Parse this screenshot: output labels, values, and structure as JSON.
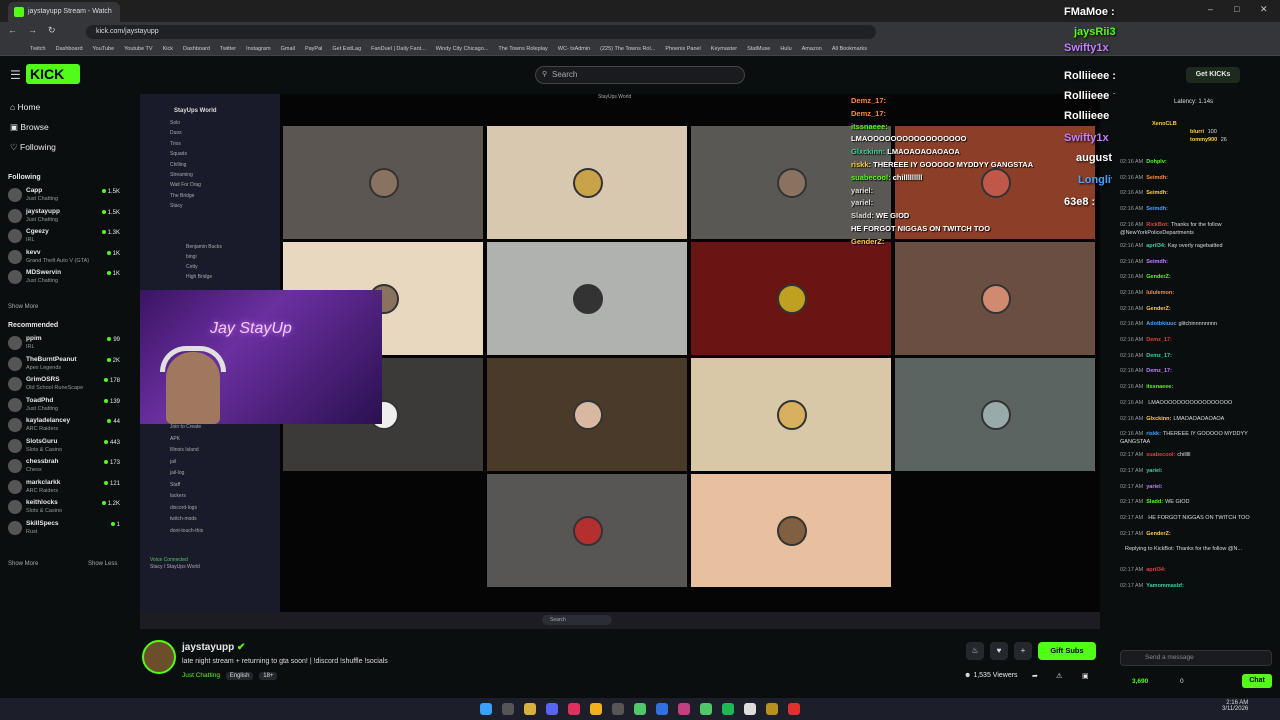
{
  "browser": {
    "tab_title": "jaystayupp Stream - Watch",
    "url": "kick.com/jaystayupp",
    "bookmarks": [
      "Twitch",
      "Dashboard",
      "YouTube",
      "Youtube TV",
      "Kick",
      "Dashboard",
      "Twitter",
      "Instagram",
      "Gmail",
      "PayPal",
      "Get ExitLag",
      "FanDuel | Daily Fant...",
      "Windy City Chicago...",
      "The Towns Roleplay",
      "WC- txAdmin",
      "(225) The Towns Rol...",
      "Phoenix Panel",
      "Keymaster",
      "StatMuse",
      "Hulu",
      "Amazon",
      "All Bookmarks"
    ]
  },
  "header": {
    "logo_text": "KICK",
    "search_placeholder": "Search",
    "get_kicks_label": "Get KICKs"
  },
  "sidebar": {
    "nav": [
      "Home",
      "Browse",
      "Following"
    ],
    "following_label": "Following",
    "following": [
      {
        "name": "Capp",
        "category": "Just Chatting",
        "viewers": "1.5K"
      },
      {
        "name": "jaystayupp",
        "category": "Just Chatting",
        "viewers": "1.5K"
      },
      {
        "name": "Cgeezy",
        "category": "IRL",
        "viewers": "1.3K"
      },
      {
        "name": "kevv",
        "category": "Grand Theft Auto V (GTA)",
        "viewers": "1K"
      },
      {
        "name": "MDSwervin",
        "category": "Just Chatting",
        "viewers": "1K"
      }
    ],
    "show_more_1": "Show More",
    "recommended_label": "Recommended",
    "recommended": [
      {
        "name": "ppim",
        "category": "IRL",
        "viewers": "99"
      },
      {
        "name": "TheBurntPeanut",
        "category": "Apex Legends",
        "viewers": "2K"
      },
      {
        "name": "GrimOSRS",
        "category": "Old School RuneScape",
        "viewers": "178"
      },
      {
        "name": "ToadPhd",
        "category": "Just Chatting",
        "viewers": "139"
      },
      {
        "name": "kayladelancey",
        "category": "ARC Raiders",
        "viewers": "44"
      },
      {
        "name": "SlotsGuru",
        "category": "Slots & Casino",
        "viewers": "443"
      },
      {
        "name": "chessbrah",
        "category": "Chess",
        "viewers": "173"
      },
      {
        "name": "markclarkk",
        "category": "ARC Raiders",
        "viewers": "121"
      },
      {
        "name": "keithlocks",
        "category": "Slots & Casino",
        "viewers": "1.2K"
      },
      {
        "name": "SkillSpecs",
        "category": "Rust",
        "viewers": "1"
      }
    ],
    "show_more_2": "Show More",
    "show_less": "Show Less"
  },
  "video": {
    "server_name": "StayUps World",
    "window_title": "StayUps World",
    "channels": [
      "Solo",
      "Duos",
      "Trios",
      "Squads",
      "Chilling",
      "Streaming",
      "Wait For Drag",
      "The Bridge",
      "Stacy"
    ],
    "members": [
      "Benjamin Bucks",
      "bingi",
      "Cetty",
      "High Bridge"
    ],
    "lower_channels": [
      "Join to Create",
      "APK",
      "Illinois Island",
      "jail",
      "jail-log",
      "Staff",
      "lackers",
      "discord-logs",
      "twitch-mods",
      "dont-touch-this"
    ],
    "voice_status": "Voice Connected",
    "voice_sub": "Stacy / StayUps World",
    "webcam_sign": "Jay StayUp",
    "taskbar_search": "Search",
    "overlay_chat": [
      {
        "user": "Demz_17:",
        "text": ""
      },
      {
        "user": "Demz_17:",
        "text": ""
      },
      {
        "user": "itssnaeee:",
        "text": ""
      },
      {
        "user": "",
        "text": "LMAOOOOOOOOOOOOOOOOO"
      },
      {
        "user": "Glxckinn:",
        "text": "LMAOAOAOAOAOA"
      },
      {
        "user": "riskk:",
        "text": "THEREEE IY GOOOOO MYDDYY GANGSTAA"
      },
      {
        "user": "suabecool:",
        "text": "chilllllllll"
      },
      {
        "user": "yariel:",
        "text": ""
      },
      {
        "user": "yariel:",
        "text": ""
      },
      {
        "user": "Sladd:",
        "text": "WE GIOD"
      },
      {
        "user": "",
        "text": "HE FORGOT NIGGAS ON TWITCH TOO"
      },
      {
        "user": "GenderZ:",
        "text": ""
      }
    ],
    "viewer_overlay": [
      "FMaMoe :",
      "jaysRii3",
      "Swifty1x",
      "Rolliieee :",
      "Rolliieee :",
      "Rolliieee :",
      "Swifty1x :",
      "augustbourne :",
      "Longlivelum :",
      "63e8 :"
    ]
  },
  "chat": {
    "latency": "Latency: 1.14s",
    "leaderboard": [
      {
        "name": "XenoCLB",
        "value": ""
      },
      {
        "name": "blurri",
        "value": "100"
      },
      {
        "name": "tommy900",
        "value": "26"
      }
    ],
    "messages": [
      {
        "time": "02:16 AM",
        "user": "Dohplv:",
        "text": ""
      },
      {
        "time": "02:16 AM",
        "user": "Seimdh:",
        "text": ""
      },
      {
        "time": "02:16 AM",
        "user": "Seimdh:",
        "text": ""
      },
      {
        "time": "02:16 AM",
        "user": "Seimdh:",
        "text": ""
      },
      {
        "time": "02:16 AM",
        "user": "RickBot:",
        "text": "Thanks for the follow @NewYorkPoliceDepartments"
      },
      {
        "time": "02:16 AM",
        "user": "april34:",
        "text": "Kay overly ragebaitted"
      },
      {
        "time": "02:16 AM",
        "user": "Seimdh:",
        "text": ""
      },
      {
        "time": "02:16 AM",
        "user": "GenderZ:",
        "text": ""
      },
      {
        "time": "02:16 AM",
        "user": "lululemon:",
        "text": ""
      },
      {
        "time": "02:16 AM",
        "user": "GenderZ:",
        "text": ""
      },
      {
        "time": "02:16 AM",
        "user": "Adotbkiuuc",
        "text": "glitchinnnnnnnn"
      },
      {
        "time": "02:16 AM",
        "user": "Demz_17:",
        "text": ""
      },
      {
        "time": "02:16 AM",
        "user": "Demz_17:",
        "text": ""
      },
      {
        "time": "02:16 AM",
        "user": "Demz_17:",
        "text": ""
      },
      {
        "time": "02:16 AM",
        "user": "itssnaeee:",
        "text": ""
      },
      {
        "time": "02:16 AM",
        "user": "",
        "text": "LMAOOOOOOOOOOOOOOOOO"
      },
      {
        "time": "02:16 AM",
        "user": "Glxckinn:",
        "text": "LMAOAOAOAOAOA"
      },
      {
        "time": "02:16 AM",
        "user": "riskk:",
        "text": "THEREEE IY GOOOOO MYDDYY GANGSTAA"
      },
      {
        "time": "02:17 AM",
        "user": "suabecool:",
        "text": "chilllll"
      },
      {
        "time": "02:17 AM",
        "user": "yariel:",
        "text": ""
      },
      {
        "time": "02:17 AM",
        "user": "yariel:",
        "text": ""
      },
      {
        "time": "02:17 AM",
        "user": "Sladd:",
        "text": "WE GIOD"
      },
      {
        "time": "02:17 AM",
        "user": "",
        "text": "HE FORGOT NIGGAS ON TWITCH TOO"
      },
      {
        "time": "02:17 AM",
        "user": "GenderZ:",
        "text": ""
      },
      {
        "time": "",
        "user": "",
        "text": "Replying to KickBot: Thanks for the follow @N..."
      },
      {
        "time": "02:17 AM",
        "user": "april34:",
        "text": ""
      },
      {
        "time": "02:17 AM",
        "user": "Yamommasbf:",
        "text": ""
      }
    ],
    "send_placeholder": "Send a message",
    "points": "3,690",
    "count": "0",
    "chat_button": "Chat"
  },
  "stream": {
    "streamer": "jaystayupp",
    "title": "late night stream + returning to gta soon! | !discord !shuffle !socials",
    "category": "Just Chatting",
    "tags": [
      "English",
      "18+"
    ],
    "viewers": "1,535 Viewers",
    "gift_label": "Gift Subs"
  },
  "taskbar": {
    "time": "2:16 AM",
    "date": "3/11/2026"
  },
  "colors": {
    "accent": "#53fc18",
    "background": "#0b0e0f"
  }
}
